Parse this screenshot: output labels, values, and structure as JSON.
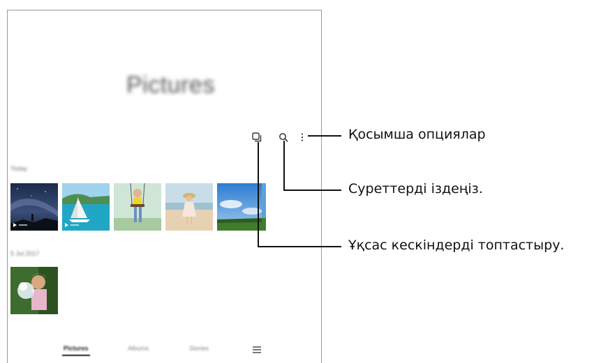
{
  "app": {
    "title": "Pictures",
    "sections": [
      {
        "label": "Today"
      },
      {
        "label": "5 Jul 2017"
      }
    ],
    "nav": {
      "tabs": [
        "Pictures",
        "Albums",
        "Stories"
      ],
      "active": "Pictures",
      "menu_icon": "hamburger-icon"
    },
    "toolbar": {
      "icons": [
        "similar-images-icon",
        "search-icon",
        "more-options-icon"
      ]
    }
  },
  "callouts": {
    "more_options": "Қосымша опциялар",
    "search": "Суреттерді іздеңіз.",
    "group_similar": "Ұқсас кескіндерді топтастыру."
  }
}
